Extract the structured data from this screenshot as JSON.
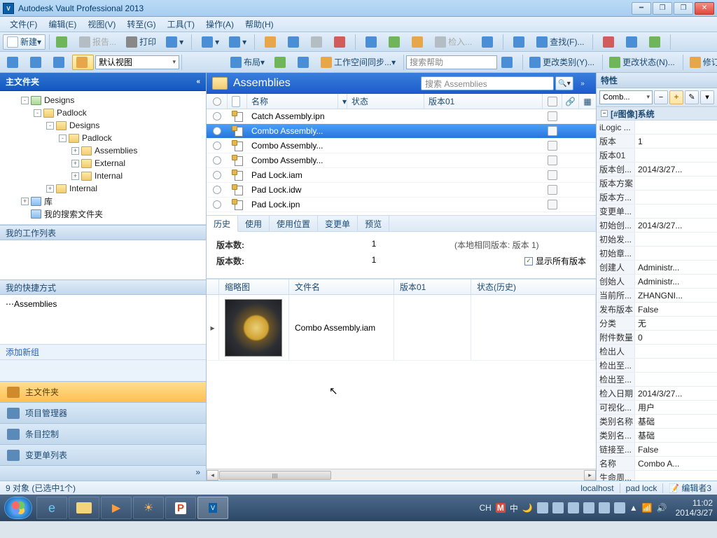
{
  "app": {
    "title": "Autodesk Vault Professional 2013"
  },
  "menu": [
    "文件(F)",
    "编辑(E)",
    "视图(V)",
    "转至(G)",
    "工具(T)",
    "操作(A)",
    "帮助(H)"
  ],
  "toolbar1": {
    "new": "新建",
    "report": "报告...",
    "print": "打印",
    "checkin": "检入...",
    "find": "查找(F)..."
  },
  "toolbar2": {
    "viewdd": "默认视图",
    "layout": "布局",
    "workspace": "工作空间同步...",
    "searchhelp": "搜索帮助",
    "changecat": "更改类别(Y)...",
    "changestate": "更改状态(N)...",
    "revision": "修订..."
  },
  "sidebar": {
    "title": "主文件夹",
    "tree": [
      {
        "pad": 30,
        "exp": "-",
        "ico": "house",
        "label": "Designs"
      },
      {
        "pad": 48,
        "exp": "-",
        "ico": "f",
        "label": "Padlock"
      },
      {
        "pad": 66,
        "exp": "-",
        "ico": "f",
        "label": "Designs"
      },
      {
        "pad": 84,
        "exp": "-",
        "ico": "f",
        "label": "Padlock"
      },
      {
        "pad": 102,
        "exp": "+",
        "ico": "f",
        "label": "Assemblies"
      },
      {
        "pad": 102,
        "exp": "+",
        "ico": "f",
        "label": "External"
      },
      {
        "pad": 102,
        "exp": "+",
        "ico": "f",
        "label": "Internal"
      },
      {
        "pad": 66,
        "exp": "+",
        "ico": "f",
        "label": "Internal"
      },
      {
        "pad": 30,
        "exp": "+",
        "ico": "sp",
        "label": "库"
      },
      {
        "pad": 30,
        "exp": "",
        "ico": "sp",
        "label": "我的搜索文件夹"
      }
    ],
    "worklist": "我的工作列表",
    "shortcut": "我的快捷方式",
    "shortcutitems": [
      "Assemblies"
    ],
    "addgroup": "添加新组",
    "navbtns": [
      "主文件夹",
      "项目管理器",
      "条目控制",
      "变更单列表"
    ]
  },
  "content": {
    "title": "Assemblies",
    "searchplaceholder": "搜索 Assemblies",
    "headers": {
      "name": "名称",
      "status": "状态",
      "ver": "版本01"
    },
    "rows": [
      {
        "name": "Catch Assembly.ipn",
        "sel": false
      },
      {
        "name": "Combo Assembly...",
        "sel": true
      },
      {
        "name": "Combo Assembly...",
        "sel": false
      },
      {
        "name": "Combo Assembly...",
        "sel": false
      },
      {
        "name": "Pad Lock.iam",
        "sel": false
      },
      {
        "name": "Pad Lock.idw",
        "sel": false
      },
      {
        "name": "Pad Lock.ipn",
        "sel": false
      }
    ],
    "tabs": [
      "历史",
      "使用",
      "使用位置",
      "变更单",
      "预览"
    ],
    "activeTab": 0,
    "history": {
      "label_count": "版本数:",
      "val_count": "1",
      "extra": "(本地相同版本: 版本 1)",
      "showall": "显示所有版本",
      "thumbhead": "缩略图",
      "filehead": "文件名",
      "verhead": "版本01",
      "statushead": "状态(历史)",
      "file": "Combo Assembly.iam"
    }
  },
  "props": {
    "title": "特性",
    "dropdown": "Comb...",
    "group": "[#图像]系统",
    "rows": [
      [
        "iLogic ...",
        ""
      ],
      [
        "版本",
        "1"
      ],
      [
        "版本01",
        ""
      ],
      [
        "版本创...",
        "2014/3/27..."
      ],
      [
        "版本方案",
        ""
      ],
      [
        "版本方...",
        ""
      ],
      [
        "变更单...",
        ""
      ],
      [
        "初始创...",
        "2014/3/27..."
      ],
      [
        "初始发...",
        ""
      ],
      [
        "初始章...",
        ""
      ],
      [
        "创建人",
        "Administr..."
      ],
      [
        "创始人",
        "Administr..."
      ],
      [
        "当前所...",
        "ZHANGNI..."
      ],
      [
        "发布版本",
        "False"
      ],
      [
        "分类",
        "无"
      ],
      [
        "附件数量",
        "0"
      ],
      [
        "检出人",
        ""
      ],
      [
        "检出至...",
        ""
      ],
      [
        "检出至...",
        ""
      ],
      [
        "检入日期",
        "2014/3/27..."
      ],
      [
        "可视化...",
        "用户"
      ],
      [
        "类别名称",
        "基础"
      ],
      [
        "类别名...",
        "基础"
      ],
      [
        "链接至...",
        "False"
      ],
      [
        "名称",
        "Combo A..."
      ],
      [
        "生命周...",
        ""
      ]
    ]
  },
  "status": {
    "left": "9 对象  (已选中1个)",
    "host": "localhost",
    "project": "pad lock",
    "editors": "编辑者3"
  },
  "taskbar": {
    "lang": "CH",
    "time": "11:02",
    "date": "2014/3/27"
  }
}
